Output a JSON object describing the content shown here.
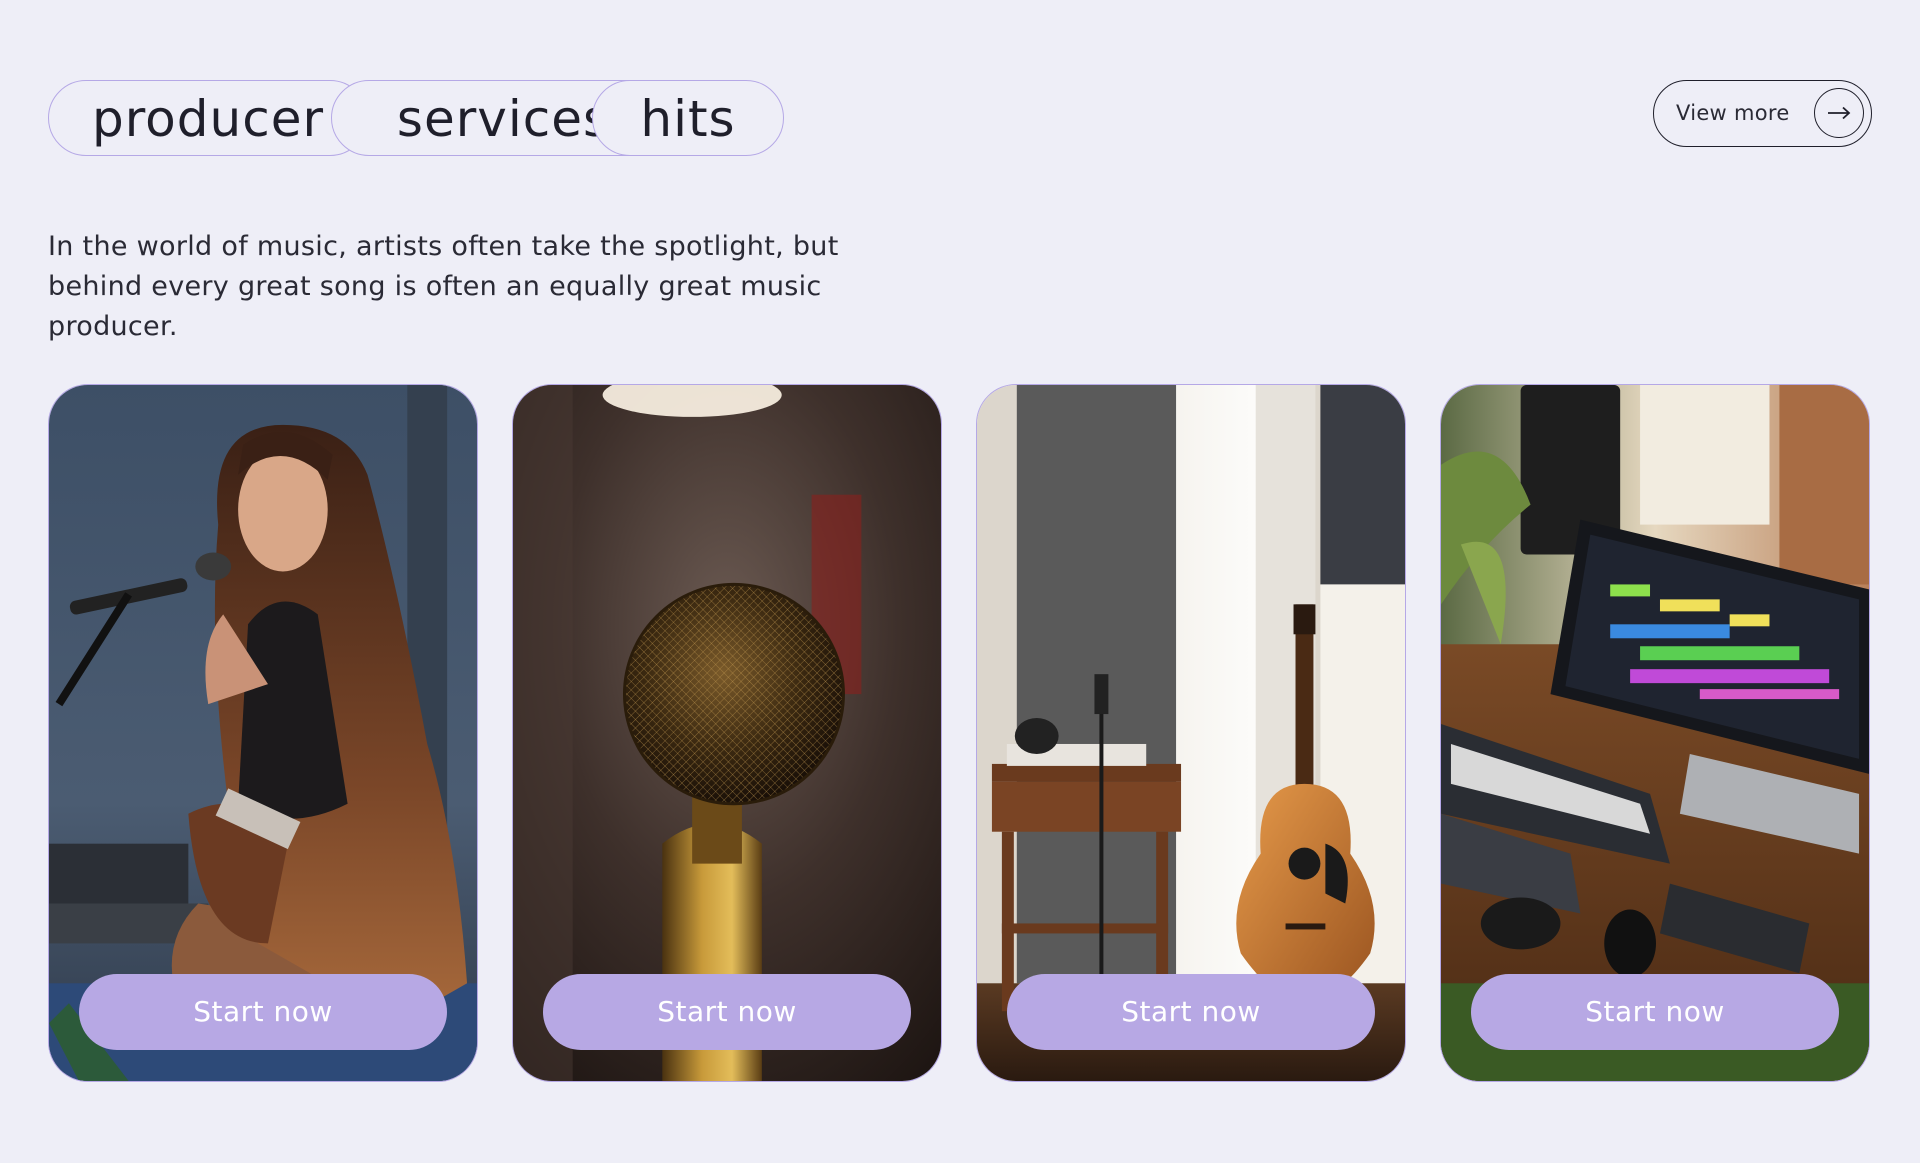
{
  "header": {
    "tags": [
      "producer",
      "services",
      "hits"
    ],
    "view_more_label": "View more"
  },
  "intro": {
    "text": "In the world of music, artists often take the spotlight, but behind every great song is often an equally great music producer."
  },
  "cards": [
    {
      "image": "woman-singing-with-guitar",
      "cta_label": "Start now"
    },
    {
      "image": "close-up-microphone",
      "cta_label": "Start now"
    },
    {
      "image": "studio-guitar-and-microphone",
      "cta_label": "Start now"
    },
    {
      "image": "production-desk-with-monitor-and-keyboard",
      "cta_label": "Start now"
    }
  ],
  "colors": {
    "background": "#eeeef7",
    "accent": "#b7a8e4",
    "border": "#b5a8e6",
    "text": "#1f1f2b"
  }
}
